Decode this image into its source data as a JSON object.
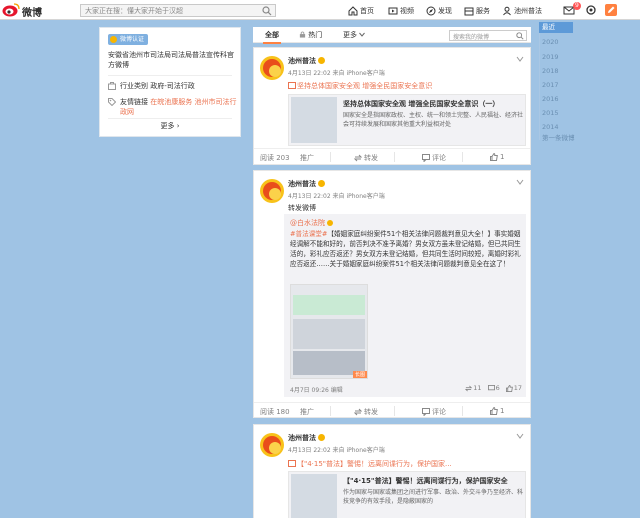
{
  "topbar": {
    "logo_text": "微博",
    "search_placeholder": "大家正在搜：懂大家开始于汉超",
    "nav": [
      "首页",
      "视频",
      "发现",
      "服务",
      "池州普法"
    ],
    "badge": "9"
  },
  "profile": {
    "auth_tag": "微博认证",
    "intro": "安徽省池州市司法局司法局普法宣传科官方微博",
    "industry": "行业类别  政府-司法行政",
    "friend_label": "友情链接",
    "friend_links": "在皖池康服务 池州市司法行政网",
    "more": "更多 ›"
  },
  "tabs": {
    "items": [
      "全部",
      "热门",
      "更多"
    ],
    "search_placeholder": "搜索我的微博"
  },
  "posts": [
    {
      "name": "池州普法",
      "meta": "4月13日 22:02 来自 iPhone客户端",
      "link_text": "坚持总体国家安全观 增强全民国家安全意识",
      "card_title": "坚持总体国家安全观 增强全民国家安全意识（一）",
      "card_desc": "国家安全是指国家政权、主权、统一和领土完整、人民福祉、经济社会可持续发展和国家其他重大利益相对处",
      "actions": [
        "阅读 203",
        "推广",
        "转发",
        "评论",
        "1"
      ]
    },
    {
      "name": "池州普法",
      "meta": "4月13日 22:02 来自 iPhone客户端",
      "text": "转发微博",
      "repost_author": "@白水法院",
      "repost_tag": "#普法课堂#",
      "repost_text": "【婚姻家庭纠纷案件51个相关法律问题裁判意见大全！】事实婚姻经调解不能和好的，前否判决不准予离婚？男女双方虽未登记结婚，但已共同生活的，彩礼应否返还？男女双方未登记结婚，但共同生活时间较短，离婚时彩礼应否返还……关于婚姻家庭纠纷案件51个相关法律问题裁判意见全在这了！",
      "img_label": "长图",
      "repost_meta": "4月7日 09:26  编辑",
      "repost_stats": [
        "11",
        "6",
        "17"
      ],
      "actions": [
        "阅读 180",
        "推广",
        "转发",
        "评论",
        "1"
      ]
    },
    {
      "name": "池州普法",
      "meta": "4月13日 22:02 来自 iPhone客户端",
      "link_text": "【\"4·15\"普法】警惕！远离间谍行为，保护国家...",
      "card_title": "【\"4·15\"普法】警惕！远离间谍行为，保护国家安全",
      "card_desc": "作为国家与国家或集团之间进行军事、政治、外交斗争乃至经济、科技竞争的有效手段，是隐蔽国家的"
    }
  ],
  "timeline": {
    "years": [
      "最近",
      "2020",
      "2019",
      "2018",
      "2017",
      "2016",
      "2015",
      "2014",
      "第一条微博"
    ]
  }
}
